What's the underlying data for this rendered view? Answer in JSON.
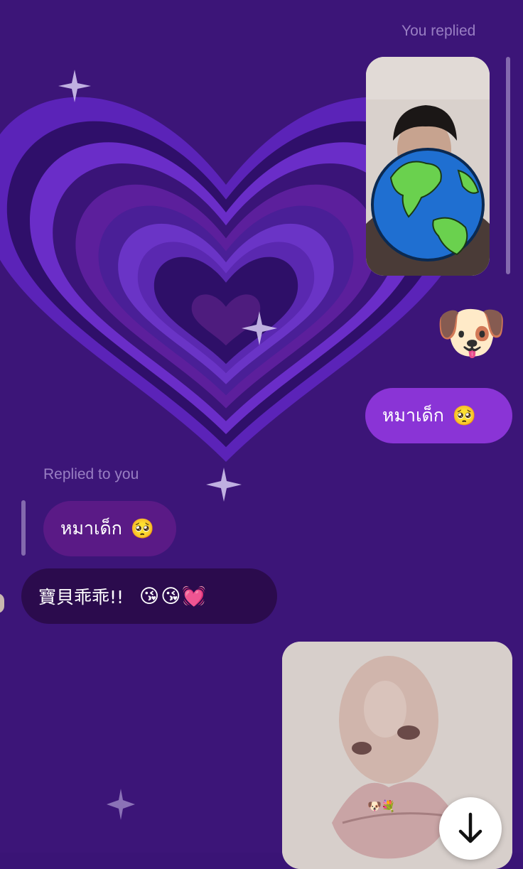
{
  "theme": {
    "background": "#3a1476",
    "sent_bubble_color": "#8a34d6",
    "received_bubble_color": "#5a1a86",
    "received_dark_bubble_color": "#2b0b4d"
  },
  "messages": {
    "you_replied_label": "You replied",
    "story_reply_photo": {
      "icon": "earth-americas-sticker"
    },
    "dog_emoji": "🐶",
    "sent_text": "หมาเด็ก",
    "sent_emoji": "🥺",
    "replied_to_you_label": "Replied to you",
    "quoted_text": "หมาเด็ก",
    "quoted_emoji": "🥺",
    "received_text": "寶貝乖乖!!",
    "received_emojis": "😘😘💓",
    "photo_2_stickers": "🐶💐"
  },
  "scroll_button": {
    "icon": "arrow-down-icon"
  }
}
